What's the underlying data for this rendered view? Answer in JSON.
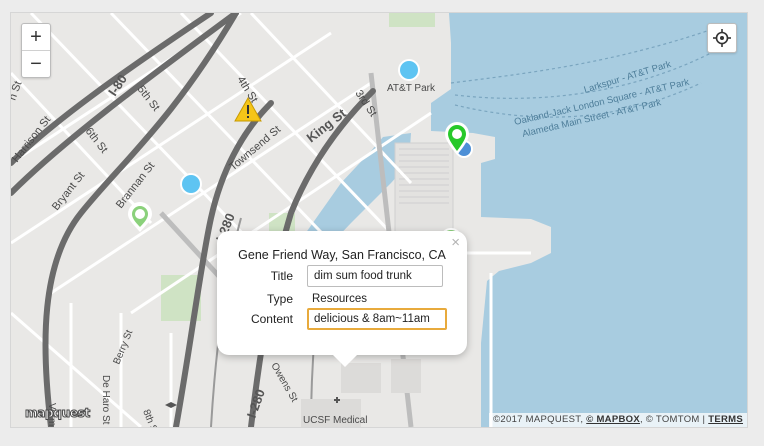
{
  "map": {
    "zoom_in_label": "+",
    "zoom_out_label": "−",
    "logo_text": "mapquest",
    "street_labels": {
      "harrison_st": "Harrison St",
      "bryant_st": "Bryant St",
      "i80": "I-80",
      "fifth_st": "5th St",
      "sixth_st": "6th St",
      "brannan_st": "Brannan St",
      "fourth_st": "4th St",
      "townsend_st": "Townsend St",
      "king_st": "King St",
      "third_st": "3rd St",
      "att_park": "AT&T Park",
      "i280_top": "I-280",
      "i280_bottom": "I-280",
      "larkspur_ferry": "Larkspur - AT&T Park",
      "oakland_ferry": "Oakland-Jack London Square - AT&T Park",
      "alameda_ferry": "Alameda Main Street - AT&T Park",
      "berry_st": "Berry St",
      "vermont_st": "Vermon",
      "de_haro_st": "De Haro St",
      "eighth_st": "8th St",
      "owens_st": "Owens St",
      "ucsf_medical": "UCSF Medical",
      "left_edge_st": "n St"
    }
  },
  "popup": {
    "address": "Gene Friend Way, San Francisco, CA",
    "close_label": "×",
    "title_label": "Title",
    "title_value": "dim sum food trunk",
    "type_label": "Type",
    "type_value": "Resources",
    "content_label": "Content",
    "content_value": "delicious & 8am~11am"
  },
  "attribution": {
    "copyright": "©2017 MAPQUEST, ",
    "mapbox_link": "© MAPBOX",
    "tomtom": ", © TOMTOM | ",
    "terms_link": "TERMS"
  },
  "colors": {
    "water": "#a8cce0",
    "land": "#e9e8e6",
    "highway": "#6b6b6b",
    "marker_blue": "#5ec4f2",
    "marker_green": "#27c92a",
    "warning": "#f5c518",
    "focus_border": "#e8aa3c"
  }
}
